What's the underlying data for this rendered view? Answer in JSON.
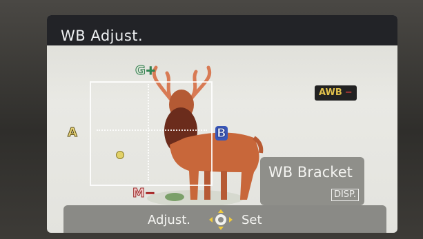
{
  "title": "WB Adjust.",
  "axis": {
    "g": "G",
    "g_sign": "+",
    "a": "A",
    "b": "B",
    "m": "M",
    "m_sign": "−"
  },
  "badge": {
    "text": "AWB",
    "sign": "−"
  },
  "bracket": {
    "label": "WB Bracket",
    "key": "DISP."
  },
  "footer": {
    "adjust": "Adjust.",
    "set": "Set"
  },
  "icons": {
    "dpad": "dpad-arrows-icon"
  },
  "colors": {
    "g": "#2f8d55",
    "a": "#e9d57a",
    "b": "#3957b8",
    "m": "#c73434",
    "awb": "#e0c04c"
  }
}
